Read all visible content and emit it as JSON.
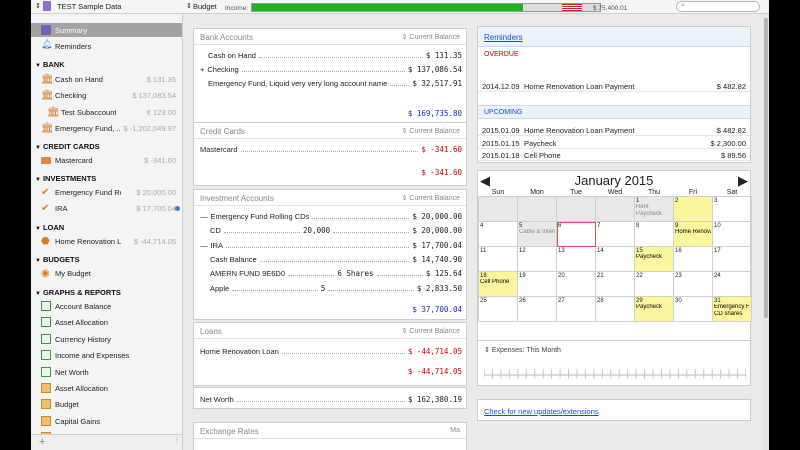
{
  "window": {
    "file_name": "TEST Sample Data",
    "view_menu": "Budget",
    "income_label": "Income:",
    "income_value": "$ 75,400.01",
    "income_progress": 0.78,
    "search_placeholder": ""
  },
  "sidebar": {
    "summary": "Summary",
    "reminders": "Reminders",
    "bank_header": "BANK",
    "bank": [
      {
        "label": "Cash on Hand",
        "value": "$ 131.35"
      },
      {
        "label": "Checking",
        "value": "$ 137,083.54"
      },
      {
        "label": "Test Subaccount",
        "value": "€ 123.00"
      },
      {
        "label": "Emergency Fund, ...",
        "value": "$ -1,202,049.97"
      }
    ],
    "credit_header": "CREDIT CARDS",
    "credit": [
      {
        "label": "Mastercard",
        "value": "$ -341.60"
      }
    ],
    "invest_header": "INVESTMENTS",
    "invest": [
      {
        "label": "Emergency Fund Rolling ...",
        "value": "$ 20,000.00"
      },
      {
        "label": "IRA",
        "value": "$ 17,700.04"
      }
    ],
    "loan_header": "LOAN",
    "loan": [
      {
        "label": "Home Renovation Loan",
        "value": "$ -44,714.05"
      }
    ],
    "budgets_header": "BUDGETS",
    "budgets": [
      {
        "label": "My Budget"
      }
    ],
    "graphs_header": "GRAPHS & REPORTS",
    "graphs": [
      {
        "label": "Account Balance"
      },
      {
        "label": "Asset Allocation"
      },
      {
        "label": "Currency History"
      },
      {
        "label": "Income and Expenses"
      },
      {
        "label": "Net Worth"
      },
      {
        "label": "Asset Allocation"
      },
      {
        "label": "Budget"
      },
      {
        "label": "Capital Gains"
      },
      {
        "label": "Cash Flow"
      }
    ],
    "add": "+",
    "gear": "⚙"
  },
  "bank_panel": {
    "title": "Bank Accounts",
    "sort": "Current Balance",
    "rows": [
      {
        "name": "Cash on Hand",
        "value": "$ 131.35"
      },
      {
        "name": "Checking",
        "value": "$ 137,086.54"
      },
      {
        "name": "Emergency Fund, Liquid very very long account name",
        "value": "$ 32,517.91"
      }
    ],
    "total": "$ 169,735.80"
  },
  "credit_panel": {
    "title": "Credit Cards",
    "sort": "Current Balance",
    "rows": [
      {
        "name": "Mastercard",
        "value": "$ -341.60"
      }
    ],
    "total": "$ -341.60"
  },
  "invest_panel": {
    "title": "Investment Accounts",
    "sort": "Current Balance",
    "rows": [
      {
        "name": "Emergency Fund Rolling CDs",
        "mid": "",
        "value": "$ 20,000.00"
      },
      {
        "name": "CD",
        "mid": "20,000",
        "value": "$ 20,000.00"
      },
      {
        "name": "IRA",
        "mid": "",
        "value": "$ 17,700.04"
      },
      {
        "name": "Cash Balance",
        "mid": "",
        "value": "$ 14,740.90"
      },
      {
        "name": "AMERN FUND 9E6D0",
        "mid": "6 Shares",
        "value": "$ 125.64"
      },
      {
        "name": "Apple",
        "mid": "5",
        "value": "$ 2,833.50"
      }
    ],
    "total": "$ 37,700.04"
  },
  "loans_panel": {
    "title": "Loans",
    "sort": "Current Balance",
    "rows": [
      {
        "name": "Home Renovation Loan",
        "value": "$ -44,714.05"
      }
    ],
    "total": "$ -44,714.05"
  },
  "net_worth": {
    "label": "Net Worth",
    "value": "$ 162,380.19"
  },
  "exchange": {
    "title": "Exchange Rates",
    "right": "Ma"
  },
  "reminders": {
    "title": "Reminders",
    "overdue_label": "OVERDUE",
    "overdue": [
      {
        "date": "2014.12.09",
        "name": "Home Renovation Loan Payment",
        "amount": "$ 482.82"
      }
    ],
    "upcoming_label": "UPCOMING",
    "upcoming": [
      {
        "date": "2015.01.09",
        "name": "Home Renovation Loan Payment",
        "amount": "$ 482.82"
      },
      {
        "date": "2015.01.15",
        "name": "Paycheck",
        "amount": "$ 2,300.00"
      },
      {
        "date": "2015.01.18",
        "name": "Cell Phone",
        "amount": "$ 89.56"
      }
    ]
  },
  "calendar": {
    "title": "January 2015",
    "prev": "◀",
    "next": "▶",
    "days": [
      "Sun",
      "Mon",
      "Tue",
      "Wed",
      "Thu",
      "Fri",
      "Sat"
    ],
    "weeks": [
      [
        {
          "d": ""
        },
        {
          "d": ""
        },
        {
          "d": ""
        },
        {
          "d": ""
        },
        {
          "d": "1",
          "ev": [
            "Rent",
            "Paycheck"
          ],
          "grey": true
        },
        {
          "d": "2",
          "yel": true
        },
        {
          "d": "3"
        }
      ],
      [
        {
          "d": "4"
        },
        {
          "d": "5",
          "ev": [
            "Cable & Interne"
          ],
          "grey": true
        },
        {
          "d": "6",
          "today": true
        },
        {
          "d": "7"
        },
        {
          "d": "8"
        },
        {
          "d": "9",
          "ev": [
            "Home Renova"
          ],
          "yel": true
        },
        {
          "d": "10"
        }
      ],
      [
        {
          "d": "11"
        },
        {
          "d": "12"
        },
        {
          "d": "13"
        },
        {
          "d": "14"
        },
        {
          "d": "15",
          "ev": [
            "Paycheck"
          ],
          "yel": true
        },
        {
          "d": "16"
        },
        {
          "d": "17"
        }
      ],
      [
        {
          "d": "18",
          "ev": [
            "Cell Phone"
          ],
          "yel": true
        },
        {
          "d": "19"
        },
        {
          "d": "20"
        },
        {
          "d": "21"
        },
        {
          "d": "22"
        },
        {
          "d": "23"
        },
        {
          "d": "24"
        }
      ],
      [
        {
          "d": "25"
        },
        {
          "d": "26"
        },
        {
          "d": "27"
        },
        {
          "d": "28"
        },
        {
          "d": "29",
          "ev": [
            "Paycheck"
          ],
          "yel": true
        },
        {
          "d": "30"
        },
        {
          "d": "31",
          "ev": [
            "Emergency Fu",
            "CD shares"
          ],
          "yel": true
        }
      ]
    ]
  },
  "expenses": {
    "title": "Expenses: This Month"
  },
  "updates_link": "Check for new updates/extensions",
  "colors": {
    "accent": "#1d2aa8",
    "negative": "#d00000",
    "highlight": "#fbf59c",
    "selection": "#9c9c9c"
  }
}
